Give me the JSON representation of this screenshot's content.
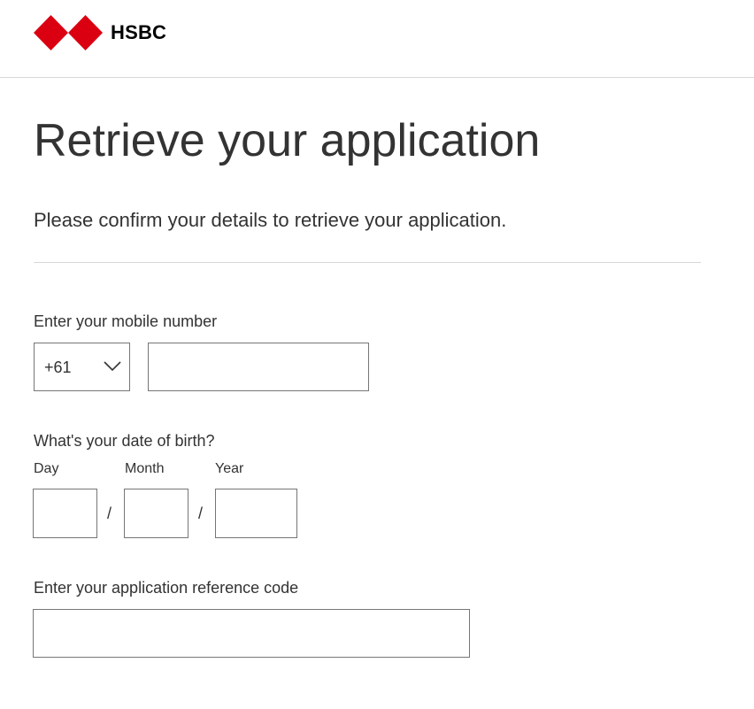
{
  "header": {
    "brand": "HSBC",
    "logo_icon": "hsbc-hexagon-logo-icon",
    "logo_colors": {
      "red": "#db0011",
      "white": "#ffffff"
    }
  },
  "page": {
    "title": "Retrieve your application",
    "subtitle": "Please confirm your details to retrieve your application."
  },
  "mobile": {
    "label": "Enter your mobile number",
    "country_code": "+61",
    "country_code_icon": "chevron-down-icon",
    "number_value": ""
  },
  "dob": {
    "label": "What's your date of birth?",
    "day_label": "Day",
    "month_label": "Month",
    "year_label": "Year",
    "separator": "/",
    "day_value": "",
    "month_value": "",
    "year_value": ""
  },
  "reference": {
    "label": "Enter your application reference code",
    "value": ""
  },
  "colors": {
    "text": "#333333",
    "border": "#767676",
    "divider": "#d7d8d6"
  }
}
